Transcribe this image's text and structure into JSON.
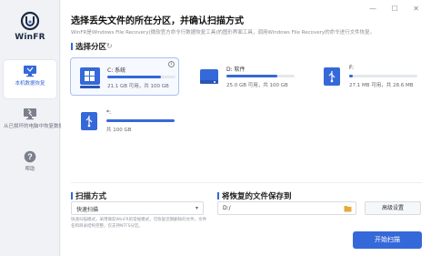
{
  "app": {
    "name": "WinFR"
  },
  "sidebar": {
    "items": [
      {
        "label": "本机数据恢复",
        "icon": "computer-icon",
        "active": true
      },
      {
        "label": "从已损坏的电脑中恢复数据",
        "icon": "damaged-computer-icon",
        "active": false
      },
      {
        "label": "帮助",
        "icon": "help-icon",
        "active": false
      }
    ]
  },
  "header": {
    "title": "选择丢失文件的所在分区，并确认扫描方式",
    "description": "WinFR是Windows File Recovery(微软官方命令行数据恢复工具)的图形界面工具，调用Windows File Recovery的命令进行文件恢复。",
    "window_controls": "— ☐ ✕"
  },
  "partition_section": {
    "label": "选择分区",
    "refresh_icon": "refresh-icon"
  },
  "drives": [
    {
      "name": "C: 系统",
      "size": "21.1 GB 可用，共 100 GB",
      "used_fraction": 0.79,
      "icon": "windows-drive-icon",
      "selected": true,
      "info_icon": "i"
    },
    {
      "name": "D: 软件",
      "size": "25.0 GB 可用，共 100 GB",
      "used_fraction": 0.75,
      "icon": "drive-icon",
      "selected": false
    },
    {
      "name": "F:",
      "size": "27.1 MB 可用，共 28.6 MB",
      "used_fraction": 0.05,
      "icon": "usb-drive-icon",
      "selected": false
    },
    {
      "name": "*:",
      "size": "共 100 GB",
      "used_fraction": 1.0,
      "icon": "usb-drive-icon",
      "selected": false
    }
  ],
  "scan_section": {
    "label": "扫描方式",
    "selected": "快速扫描",
    "hint": "快速扫描模式，采用微软WinFR的常规模式，可恢复近期删除的文件，文件名和目录结构完整，仅支持NTFS分区。"
  },
  "save_section": {
    "label": "将恢复的文件保存到",
    "path": "D:/"
  },
  "buttons": {
    "advanced": "高级设置",
    "start": "开始扫描"
  },
  "colors": {
    "accent": "#3569d9"
  }
}
